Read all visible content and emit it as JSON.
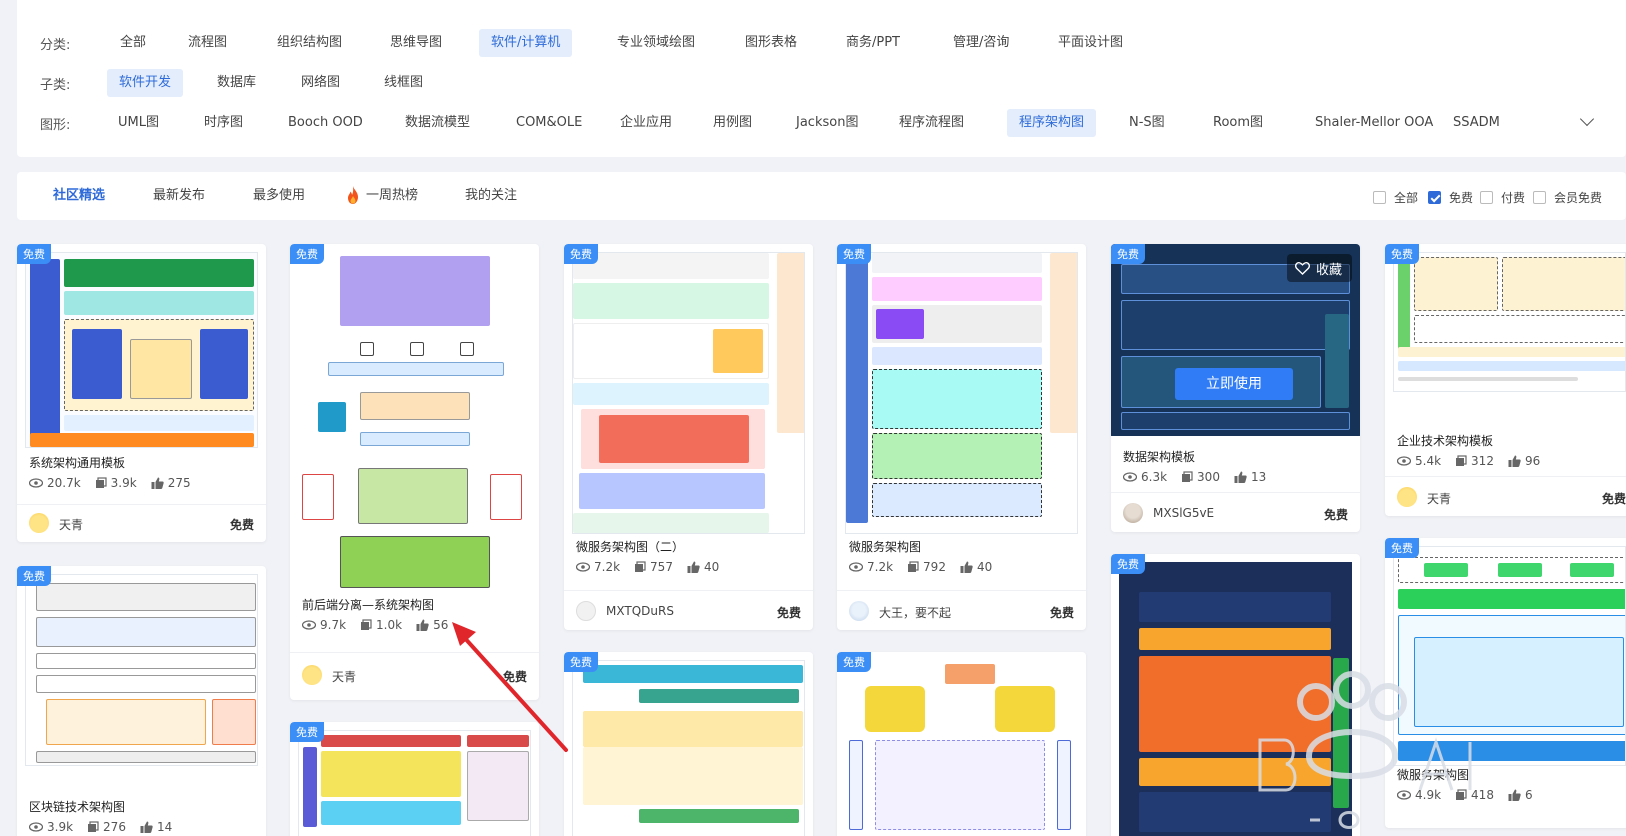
{
  "filters": {
    "category_label": "分类:",
    "categories": [
      "全部",
      "流程图",
      "组织结构图",
      "思维导图",
      "软件/计算机",
      "专业领域绘图",
      "图形表格",
      "商务/PPT",
      "管理/咨询",
      "平面设计图"
    ],
    "subcategory_label": "子类:",
    "subcategories": [
      "软件开发",
      "数据库",
      "网络图",
      "线框图"
    ],
    "shape_label": "图形:",
    "shapes": [
      "UML图",
      "时序图",
      "Booch OOD",
      "数据流模型",
      "COM&OLE",
      "企业应用",
      "用例图",
      "Jackson图",
      "程序流程图",
      "程序架构图",
      "N-S图",
      "Room图",
      "Shaler-Mellor OOA",
      "SSADM"
    ]
  },
  "tabs": [
    "社区精选",
    "最新发布",
    "最多使用",
    "一周热榜",
    "我的关注"
  ],
  "price_filters": [
    "全部",
    "免费",
    "付费",
    "会员免费"
  ],
  "cards": [
    {
      "tag": "免费",
      "title": "系统架构通用模板",
      "views": "20.7k",
      "copies": "3.9k",
      "likes": "275",
      "author": "天青",
      "price": "免费"
    },
    {
      "tag": "免费",
      "title": "前后端分离—系统架构图",
      "views": "9.7k",
      "copies": "1.0k",
      "likes": "56",
      "author": "天青",
      "price": "免费"
    },
    {
      "tag": "免费",
      "title": "微服务架构图（二）",
      "views": "7.2k",
      "copies": "757",
      "likes": "40",
      "author": "MXTQDuRS",
      "price": "免费"
    },
    {
      "tag": "免费",
      "title": "微服务架构图",
      "views": "7.2k",
      "copies": "792",
      "likes": "40",
      "author": "大王，要不起",
      "price": "免费"
    },
    {
      "tag": "免费",
      "title": "数据架构模板",
      "views": "6.3k",
      "copies": "300",
      "likes": "13",
      "author": "MXSlG5vE",
      "price": "免费",
      "use_label": "立即使用",
      "fav_label": "收藏"
    },
    {
      "tag": "免费",
      "title": "企业技术架构模板",
      "views": "5.4k",
      "copies": "312",
      "likes": "96",
      "author": "天青",
      "price": "免费"
    },
    {
      "tag": "免费",
      "title": "区块链技术架构图",
      "views": "3.9k",
      "copies": "276",
      "likes": "14"
    },
    {
      "tag": "免费"
    },
    {
      "tag": "免费"
    },
    {
      "tag": "免费"
    },
    {
      "tag": "免费"
    },
    {
      "tag": "免费",
      "title": "微服务架构图",
      "views": "4.9k",
      "copies": "418",
      "likes": "6"
    }
  ],
  "colors": {
    "accent": "#2f6bd8",
    "free_tag": "#3a8ef6",
    "arrow": "#e0262b"
  }
}
